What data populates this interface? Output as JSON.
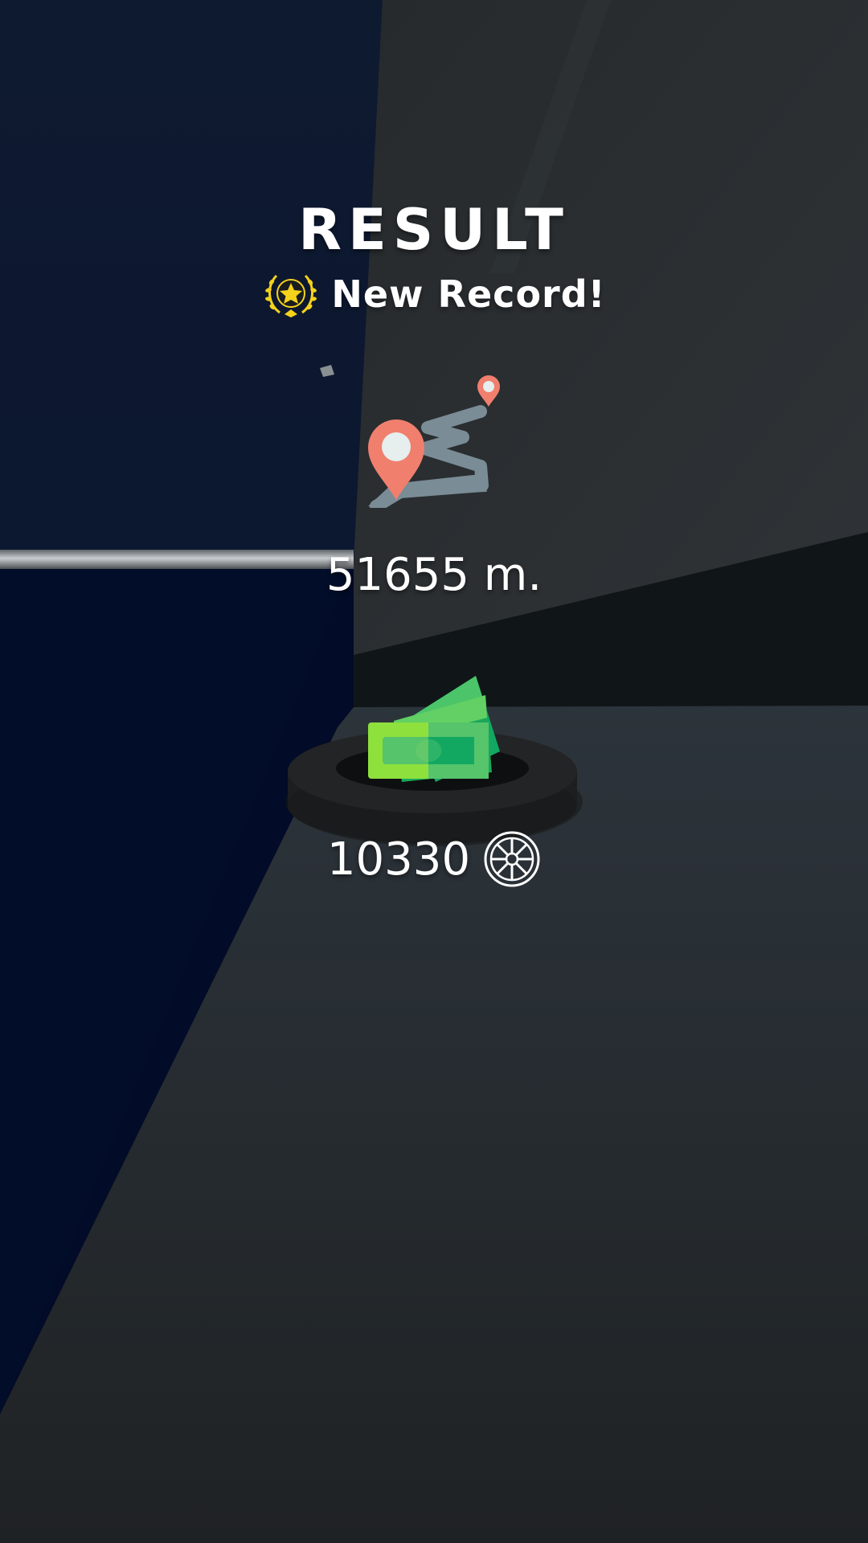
{
  "result": {
    "title": "RESULT",
    "record_label": "New Record!",
    "record_icon": "laurel-star-icon",
    "distance_icon": "route-map-pin-icon",
    "distance_value": "51655 m.",
    "cash_icon": "cash-bills-icon",
    "coins_value": "10330",
    "coins_icon": "wheel-rim-icon"
  },
  "colors": {
    "wall_left": "#0b1630",
    "wall_right": "#2a2d30",
    "floor": "#24292d",
    "pin": "#f07f6e",
    "road": "#7a8c96",
    "cash_light": "#8ee03d",
    "cash_dark": "#13a862",
    "gold": "#f5d21b"
  }
}
